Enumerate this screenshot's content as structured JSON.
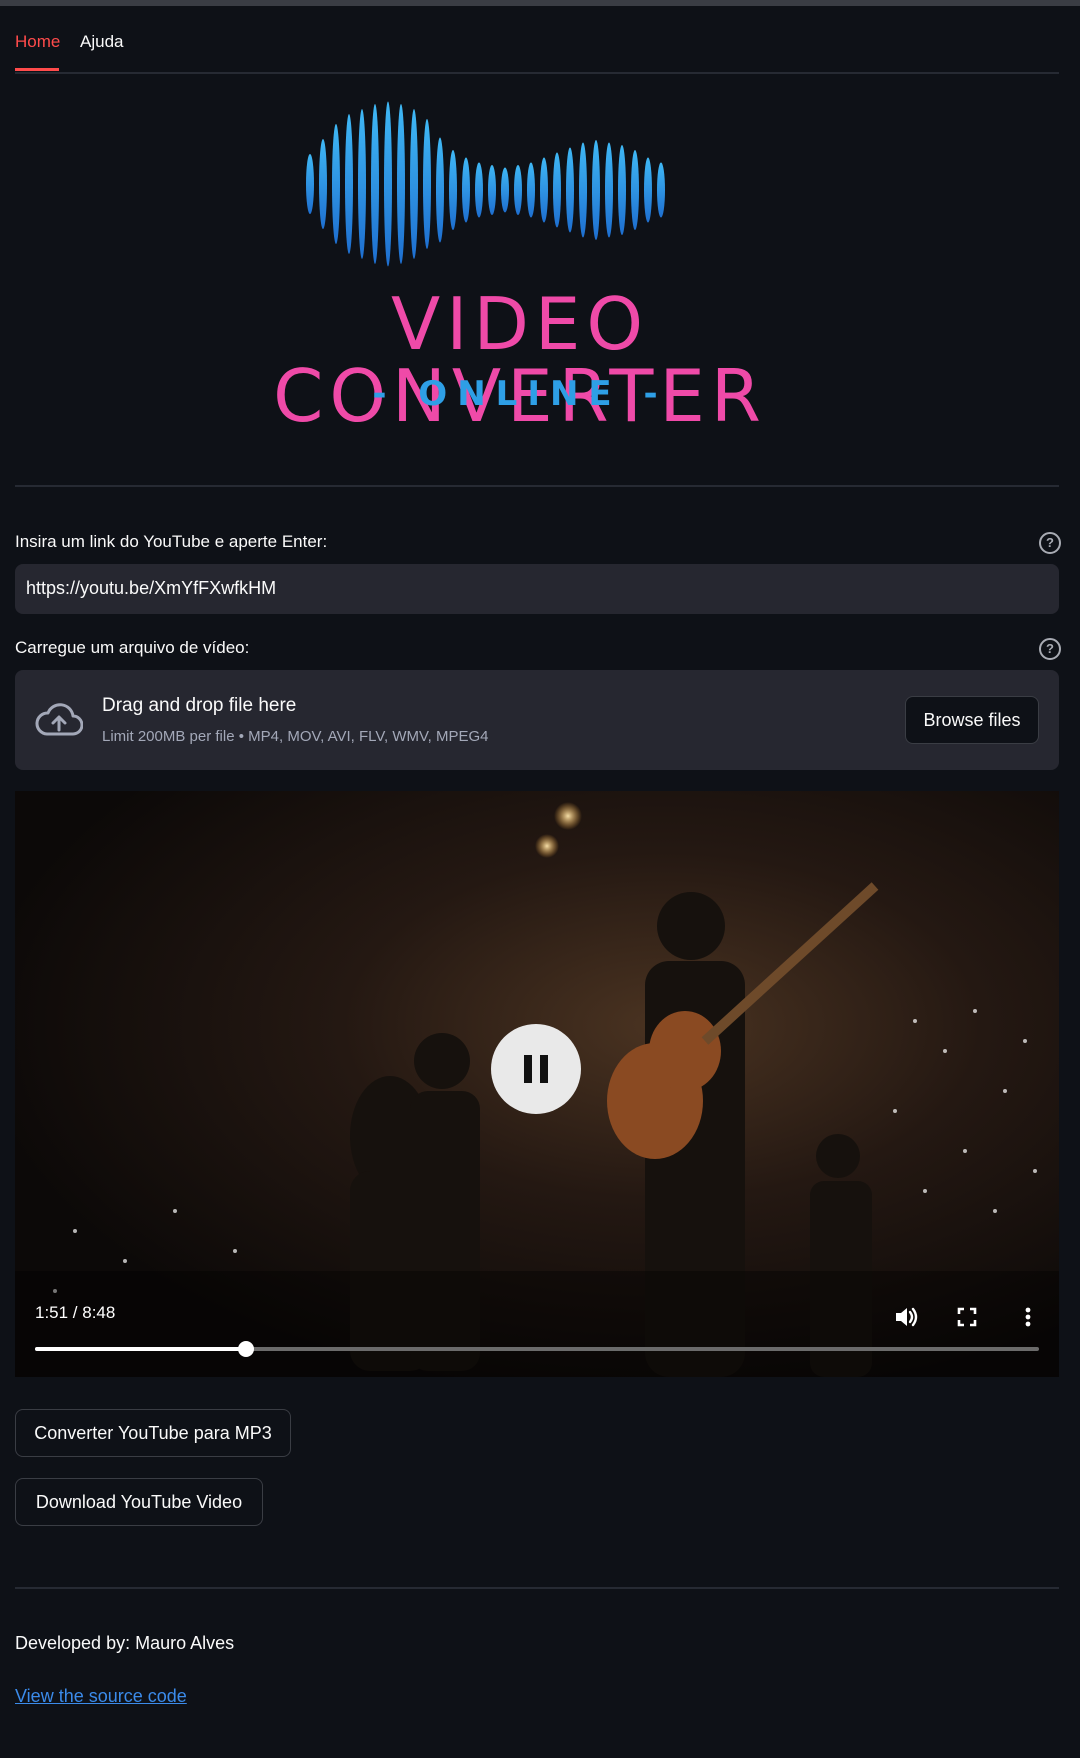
{
  "tabs": [
    {
      "label": "Home",
      "active": true
    },
    {
      "label": "Ajuda",
      "active": false
    }
  ],
  "logo": {
    "title": "VIDEO CONVERTER",
    "subtitle": "- ONLINE -",
    "title_color": "#ef4aa8",
    "subtitle_color": "#2e9fe6"
  },
  "url_section": {
    "label": "Insira um link do YouTube e aperte Enter:",
    "value": "https://youtu.be/XmYfFXwfkHM",
    "help_icon": "question-circle-icon"
  },
  "upload_section": {
    "label": "Carregue um arquivo de vídeo:",
    "help_icon": "question-circle-icon",
    "drop_title": "Drag and drop file here",
    "drop_limit": "Limit 200MB per file • MP4, MOV, AVI, FLV, WMV, MPEG4",
    "browse_label": "Browse files",
    "icon": "cloud-upload-icon"
  },
  "video": {
    "time": "1:51 / 8:48",
    "progress_fraction": 0.21,
    "state": "playing"
  },
  "buttons": {
    "mp3": "Converter YouTube para MP3",
    "download": "Download YouTube Video"
  },
  "footer": {
    "developed_by": "Developed by: Mauro Alves",
    "source_link": "View the source code"
  },
  "colors": {
    "background": "#0e1117",
    "accent": "#ff4b4b",
    "input_bg": "#262730",
    "link": "#3b8bea"
  }
}
